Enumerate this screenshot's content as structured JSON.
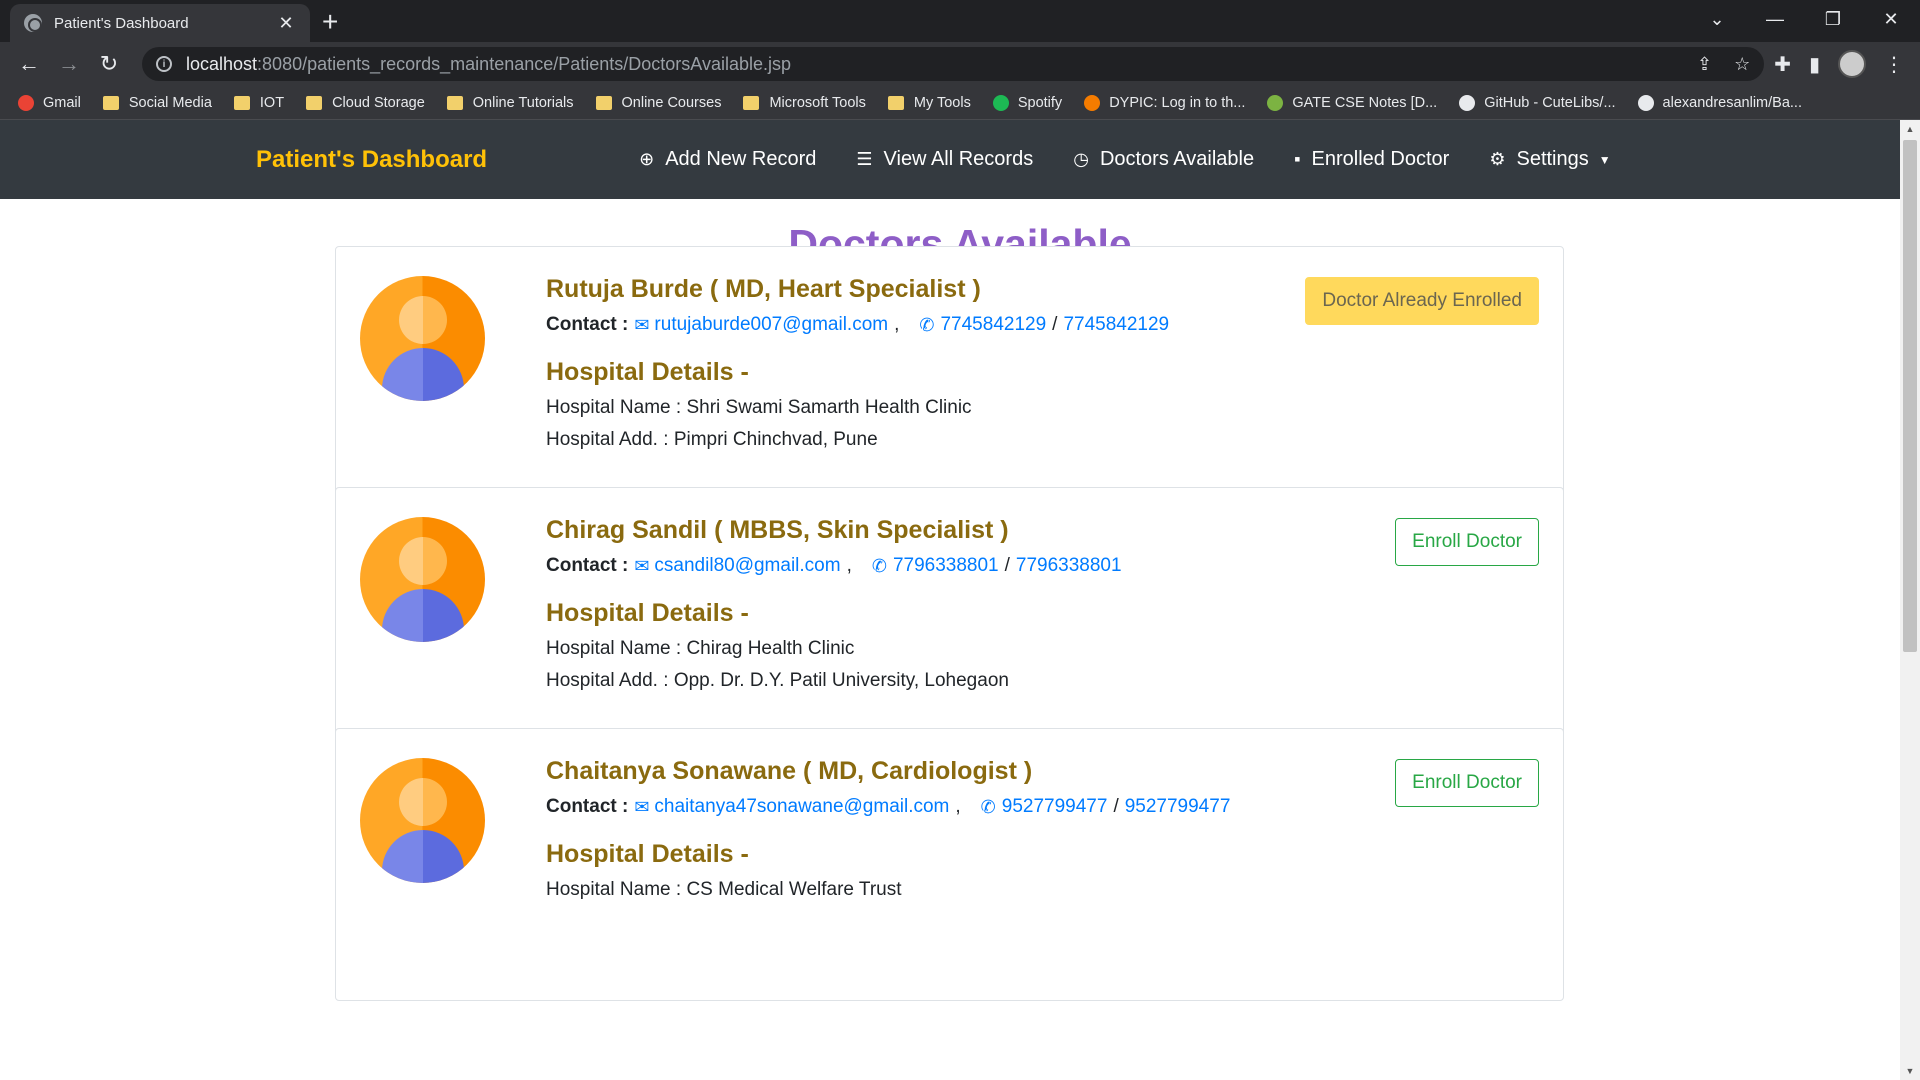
{
  "browser": {
    "tab_title": "Patient's Dashboard",
    "url_host": "localhost",
    "url_rest": ":8080/patients_records_maintenance/Patients/DoctorsAvailable.jsp",
    "bookmarks": [
      {
        "label": "Gmail",
        "kind": "gmail"
      },
      {
        "label": "Social Media",
        "kind": "folder"
      },
      {
        "label": "IOT",
        "kind": "folder"
      },
      {
        "label": "Cloud Storage",
        "kind": "folder"
      },
      {
        "label": "Online Tutorials",
        "kind": "folder"
      },
      {
        "label": "Online Courses",
        "kind": "folder"
      },
      {
        "label": "Microsoft Tools",
        "kind": "folder"
      },
      {
        "label": "My Tools",
        "kind": "folder"
      },
      {
        "label": "Spotify",
        "kind": "spotify"
      },
      {
        "label": "DYPIC: Log in to th...",
        "kind": "dypic"
      },
      {
        "label": "GATE CSE Notes [D...",
        "kind": "gate"
      },
      {
        "label": "GitHub - CuteLibs/...",
        "kind": "github"
      },
      {
        "label": "alexandresanlim/Ba...",
        "kind": "github"
      }
    ]
  },
  "navbar": {
    "brand": "Patient's Dashboard",
    "links": [
      {
        "label": "Add New Record",
        "icon": "plus-circle-icon"
      },
      {
        "label": "View All Records",
        "icon": "list-icon"
      },
      {
        "label": "Doctors Available",
        "icon": "clock-icon"
      },
      {
        "label": "Enrolled Doctor",
        "icon": "note-icon"
      },
      {
        "label": "Settings",
        "icon": "gear-icon"
      }
    ]
  },
  "page": {
    "title": "Doctors Available",
    "contact_label": "Contact :",
    "hospital_heading": "Hospital Details -",
    "hospital_name_label": "Hospital Name :",
    "hospital_add_label": "Hospital Add. :"
  },
  "doctors": [
    {
      "name": "Rutuja Burde ( MD, Heart Specialist )",
      "email": "rutujaburde007@gmail.com",
      "phone1": "7745842129",
      "phone2": "7745842129",
      "hospital_name": "Shri Swami Samarth Health Clinic",
      "hospital_add": "Pimpri Chinchvad, Pune",
      "button": "Doctor Already Enrolled",
      "enrolled": true
    },
    {
      "name": "Chirag Sandil ( MBBS, Skin Specialist )",
      "email": "csandil80@gmail.com",
      "phone1": "7796338801",
      "phone2": "7796338801",
      "hospital_name": "Chirag Health Clinic",
      "hospital_add": "Opp. Dr. D.Y. Patil University, Lohegaon",
      "button": "Enroll Doctor",
      "enrolled": false
    },
    {
      "name": "Chaitanya Sonawane ( MD, Cardiologist )",
      "email": "chaitanya47sonawane@gmail.com",
      "phone1": "9527799477",
      "phone2": "9527799477",
      "hospital_name": "CS Medical Welfare Trust",
      "hospital_add": "",
      "button": "Enroll Doctor",
      "enrolled": false
    }
  ]
}
